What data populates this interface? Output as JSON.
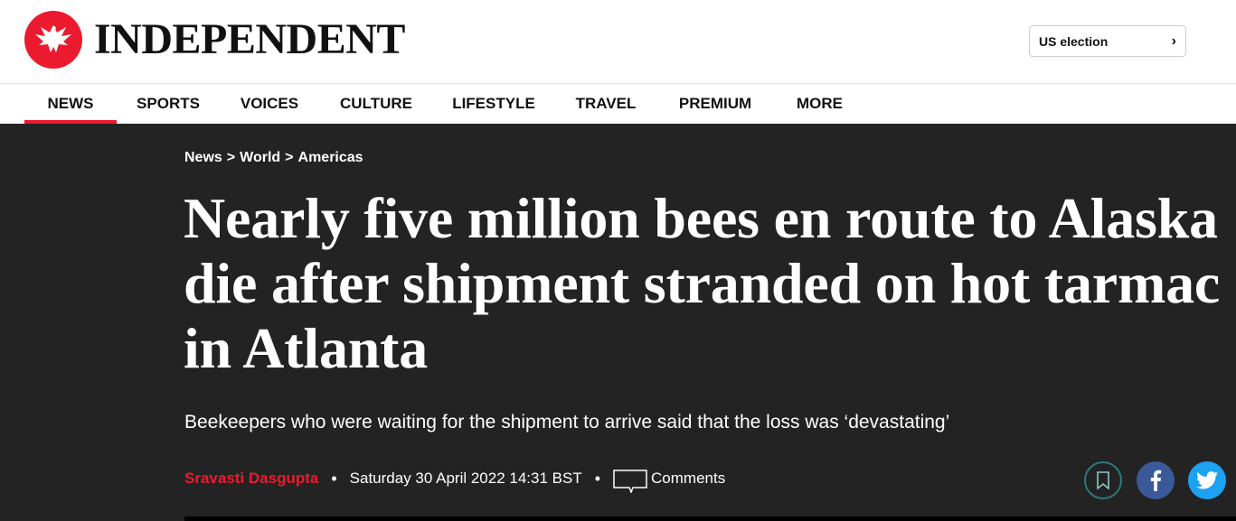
{
  "masthead": {
    "logo_text": "INDEPENDENT",
    "us_election_label": "US election",
    "chevron": "›"
  },
  "nav": {
    "items": [
      {
        "label": "NEWS",
        "active": true
      },
      {
        "label": "SPORTS"
      },
      {
        "label": "VOICES"
      },
      {
        "label": "CULTURE"
      },
      {
        "label": "LIFESTYLE"
      },
      {
        "label": "TRAVEL"
      },
      {
        "label": "PREMIUM"
      },
      {
        "label": "MORE"
      }
    ]
  },
  "article": {
    "breadcrumb": [
      "News",
      "World",
      "Americas"
    ],
    "breadcrumb_sep": ">",
    "headline": "Nearly five million bees en route to Alaska die after shipment stranded on hot tarmac in Atlanta",
    "standfirst": "Beekeepers who were waiting for the shipment to arrive said that the loss was ‘devastating’",
    "author": "Sravasti Dasgupta",
    "date": "Saturday 30 April 2022 14:31 BST",
    "comments_label": "Comments",
    "bullet": "•"
  },
  "icons": {
    "logo": "eagle-logo-icon",
    "bookmark": "bookmark-icon",
    "facebook": "facebook-icon",
    "twitter": "twitter-icon",
    "comments": "comment-bubble-icon"
  },
  "colors": {
    "brand_red": "#ec1a2e",
    "hero_bg": "#232323",
    "facebook": "#3b5998",
    "twitter": "#1da1f2",
    "bookmark_ring": "#2c7a7b"
  }
}
